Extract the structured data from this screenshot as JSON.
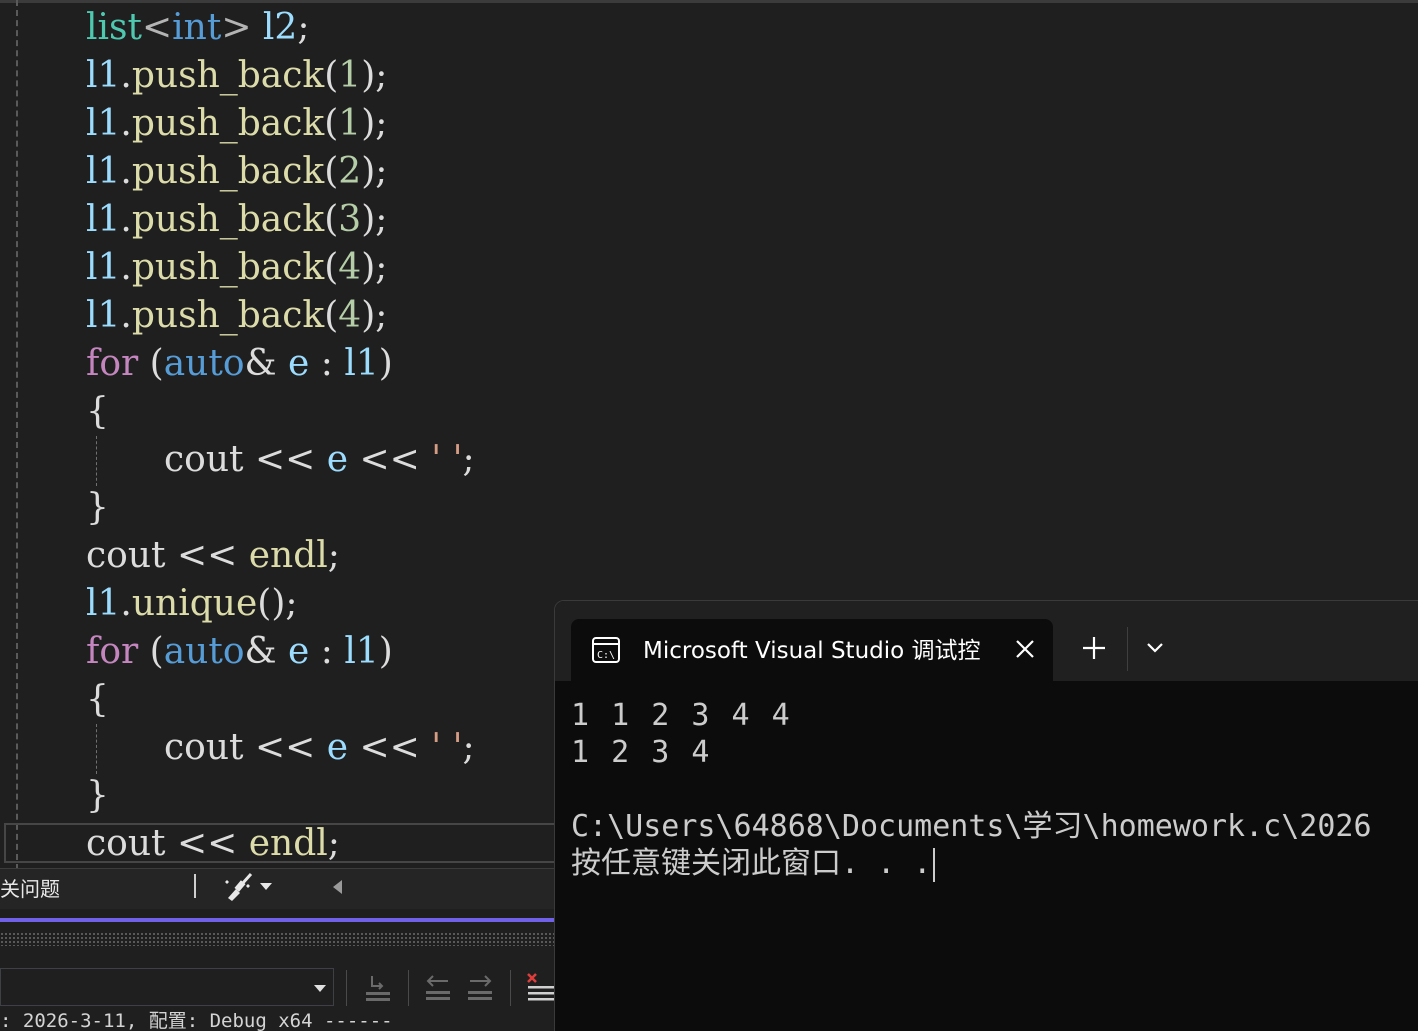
{
  "editor": {
    "lines": [
      {
        "tokens": [
          {
            "t": "list",
            "c": "tok-type"
          },
          {
            "t": "<",
            "c": "tok-punc"
          },
          {
            "t": "int",
            "c": "tok-kw-blue"
          },
          {
            "t": "> ",
            "c": "tok-punc"
          },
          {
            "t": "l2",
            "c": "tok-var"
          },
          {
            "t": ";",
            "c": "tok-plain"
          }
        ]
      },
      {
        "tokens": [
          {
            "t": "l1",
            "c": "tok-var"
          },
          {
            "t": ".",
            "c": "tok-plain"
          },
          {
            "t": "push_back",
            "c": "tok-fn"
          },
          {
            "t": "(",
            "c": "tok-plain"
          },
          {
            "t": "1",
            "c": "tok-num"
          },
          {
            "t": ");",
            "c": "tok-plain"
          }
        ]
      },
      {
        "tokens": [
          {
            "t": "l1",
            "c": "tok-var"
          },
          {
            "t": ".",
            "c": "tok-plain"
          },
          {
            "t": "push_back",
            "c": "tok-fn"
          },
          {
            "t": "(",
            "c": "tok-plain"
          },
          {
            "t": "1",
            "c": "tok-num"
          },
          {
            "t": ");",
            "c": "tok-plain"
          }
        ]
      },
      {
        "tokens": [
          {
            "t": "l1",
            "c": "tok-var"
          },
          {
            "t": ".",
            "c": "tok-plain"
          },
          {
            "t": "push_back",
            "c": "tok-fn"
          },
          {
            "t": "(",
            "c": "tok-plain"
          },
          {
            "t": "2",
            "c": "tok-num"
          },
          {
            "t": ");",
            "c": "tok-plain"
          }
        ]
      },
      {
        "tokens": [
          {
            "t": "l1",
            "c": "tok-var"
          },
          {
            "t": ".",
            "c": "tok-plain"
          },
          {
            "t": "push_back",
            "c": "tok-fn"
          },
          {
            "t": "(",
            "c": "tok-plain"
          },
          {
            "t": "3",
            "c": "tok-num"
          },
          {
            "t": ");",
            "c": "tok-plain"
          }
        ]
      },
      {
        "tokens": [
          {
            "t": "l1",
            "c": "tok-var"
          },
          {
            "t": ".",
            "c": "tok-plain"
          },
          {
            "t": "push_back",
            "c": "tok-fn"
          },
          {
            "t": "(",
            "c": "tok-plain"
          },
          {
            "t": "4",
            "c": "tok-num"
          },
          {
            "t": ");",
            "c": "tok-plain"
          }
        ]
      },
      {
        "tokens": [
          {
            "t": "l1",
            "c": "tok-var"
          },
          {
            "t": ".",
            "c": "tok-plain"
          },
          {
            "t": "push_back",
            "c": "tok-fn"
          },
          {
            "t": "(",
            "c": "tok-plain"
          },
          {
            "t": "4",
            "c": "tok-num"
          },
          {
            "t": ");",
            "c": "tok-plain"
          }
        ]
      },
      {
        "tokens": [
          {
            "t": "for",
            "c": "tok-kw-purple"
          },
          {
            "t": " (",
            "c": "tok-plain"
          },
          {
            "t": "auto",
            "c": "tok-kw-blue"
          },
          {
            "t": "& ",
            "c": "tok-plain"
          },
          {
            "t": "e",
            "c": "tok-var"
          },
          {
            "t": " : ",
            "c": "tok-plain"
          },
          {
            "t": "l1",
            "c": "tok-var"
          },
          {
            "t": ")",
            "c": "tok-plain"
          }
        ]
      },
      {
        "tokens": [
          {
            "t": "{",
            "c": "tok-plain"
          }
        ]
      },
      {
        "indent": true,
        "tokens": [
          {
            "t": "cout",
            "c": "tok-plain"
          },
          {
            "t": " << ",
            "c": "tok-plain"
          },
          {
            "t": "e",
            "c": "tok-var"
          },
          {
            "t": " << ",
            "c": "tok-plain"
          },
          {
            "t": "' '",
            "c": "tok-str"
          },
          {
            "t": ";",
            "c": "tok-plain"
          }
        ]
      },
      {
        "tokens": [
          {
            "t": "}",
            "c": "tok-plain"
          }
        ]
      },
      {
        "tokens": [
          {
            "t": "cout",
            "c": "tok-plain"
          },
          {
            "t": " << ",
            "c": "tok-plain"
          },
          {
            "t": "endl",
            "c": "tok-fn"
          },
          {
            "t": ";",
            "c": "tok-plain"
          }
        ]
      },
      {
        "tokens": [
          {
            "t": "l1",
            "c": "tok-var"
          },
          {
            "t": ".",
            "c": "tok-plain"
          },
          {
            "t": "unique",
            "c": "tok-fn"
          },
          {
            "t": "();",
            "c": "tok-plain"
          }
        ]
      },
      {
        "tokens": [
          {
            "t": "for",
            "c": "tok-kw-purple"
          },
          {
            "t": " (",
            "c": "tok-plain"
          },
          {
            "t": "auto",
            "c": "tok-kw-blue"
          },
          {
            "t": "& ",
            "c": "tok-plain"
          },
          {
            "t": "e",
            "c": "tok-var"
          },
          {
            "t": " : ",
            "c": "tok-plain"
          },
          {
            "t": "l1",
            "c": "tok-var"
          },
          {
            "t": ")",
            "c": "tok-plain"
          }
        ]
      },
      {
        "tokens": [
          {
            "t": "{",
            "c": "tok-plain"
          }
        ]
      },
      {
        "indent": true,
        "tokens": [
          {
            "t": "cout",
            "c": "tok-plain"
          },
          {
            "t": " << ",
            "c": "tok-plain"
          },
          {
            "t": "e",
            "c": "tok-var"
          },
          {
            "t": " << ",
            "c": "tok-plain"
          },
          {
            "t": "' '",
            "c": "tok-str"
          },
          {
            "t": ";",
            "c": "tok-plain"
          }
        ]
      },
      {
        "tokens": [
          {
            "t": "}",
            "c": "tok-plain"
          }
        ]
      },
      {
        "tokens": [
          {
            "t": "cout",
            "c": "tok-plain"
          },
          {
            "t": " << ",
            "c": "tok-plain"
          },
          {
            "t": "endl",
            "c": "tok-fn"
          },
          {
            "t": ";",
            "c": "tok-plain"
          }
        ]
      }
    ]
  },
  "status_bar": {
    "issues_text": "关问题",
    "brush_icon": "cleanup-brush-icon",
    "dropdown_icon": "dropdown-arrow-icon",
    "scroll_icon": "scroll-left-icon",
    "accent_color": "#7160e8"
  },
  "output_panel": {
    "source_value": "",
    "text": ": 2026-3-11, 配置: Debug x64 ------",
    "icons": [
      "goto-line-icon",
      "prev-message-icon",
      "next-message-icon",
      "clear-all-icon"
    ]
  },
  "terminal": {
    "tab_title": "Microsoft Visual Studio 调试控",
    "tab_icon": "console-icon",
    "close_icon": "close-icon",
    "new_tab_icon": "plus-icon",
    "dropdown_icon": "chevron-down-icon",
    "output_lines": [
      "1 1 2 3 4 4",
      "1 2 3 4",
      "",
      "C:\\Users\\64868\\Documents\\学习\\homework.c\\2026"
    ],
    "prompt_text": "按任意键关闭此窗口. . ."
  }
}
